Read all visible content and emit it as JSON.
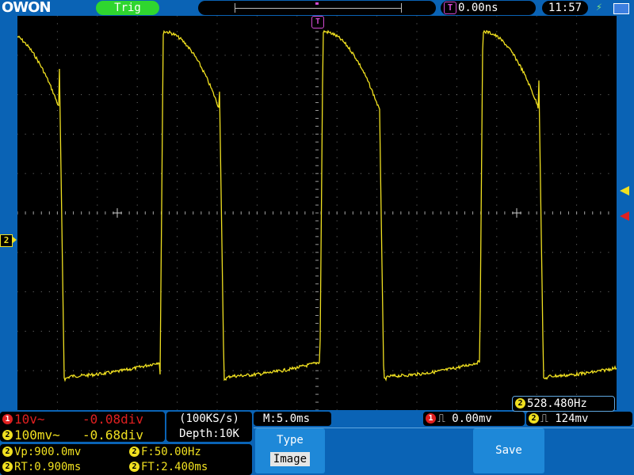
{
  "header": {
    "logo": "OWON",
    "trigger_status": "Trig",
    "trigger_position": "0.00ns",
    "clock": "11:57",
    "usb_icon": "usb-icon",
    "power_icon": "battery-icon"
  },
  "markers": {
    "trigger_marker": "T",
    "channel2_marker": "2"
  },
  "frequency": {
    "channel": "2",
    "value": "528.480Hz"
  },
  "channel1": {
    "badge": "1",
    "scale": "10v",
    "coupling": "~",
    "offset": "-0.08div"
  },
  "channel2": {
    "badge": "2",
    "scale": "100mv",
    "coupling": "~",
    "offset": "-0.68div"
  },
  "acquisition": {
    "rate": "(100KS/s)",
    "depth": "Depth:10K"
  },
  "timebase": {
    "label": "M:5.0ms"
  },
  "trigger1": {
    "channel": "1",
    "level": "0.00mv"
  },
  "trigger2": {
    "channel": "2",
    "level": "124mv"
  },
  "measurements": [
    {
      "channel": "2",
      "text": "Vp:900.0mv"
    },
    {
      "channel": "2",
      "text": "F:50.00Hz"
    },
    {
      "channel": "2",
      "text": "RT:0.900ms"
    },
    {
      "channel": "2",
      "text": "FT:2.400ms"
    }
  ],
  "menu": {
    "type_label": "Type",
    "type_value": "Image",
    "save_label": "Save"
  },
  "colors": {
    "background": "#0a63b5",
    "screen": "#000000",
    "channel1": "#e02020",
    "channel2": "#f0e020",
    "trigger": "#d24ad2",
    "status_ok": "#2fd62f"
  },
  "waveform": {
    "channel": "2",
    "period_divisions": 4,
    "high_level_divisions": 4.6,
    "low_level_divisions": -4.1
  }
}
